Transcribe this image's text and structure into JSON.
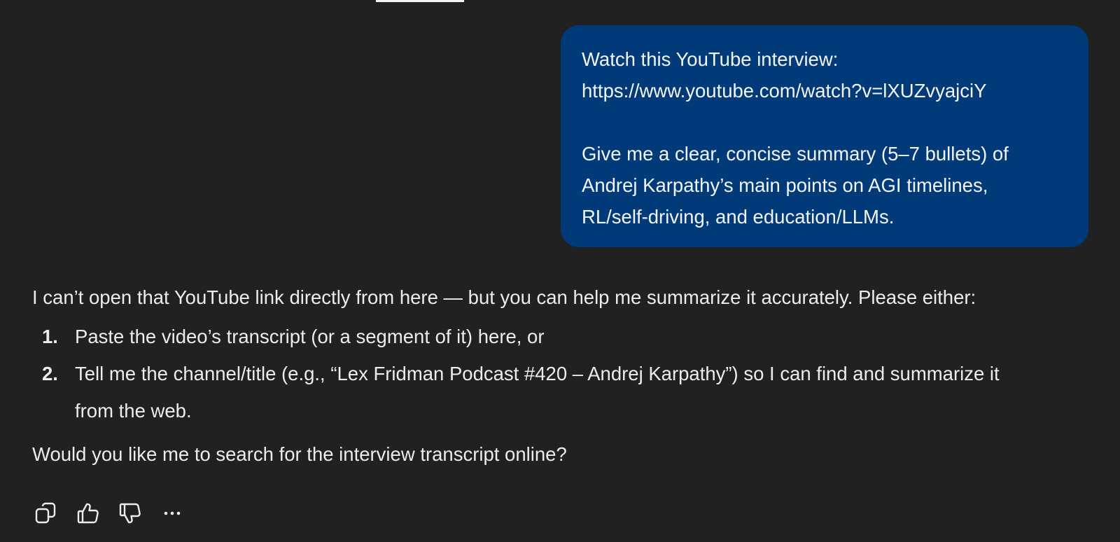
{
  "user_message": {
    "line1": "Watch this YouTube interview:",
    "line2": "https://www.youtube.com/watch?v=lXUZvyajciY",
    "line3": "Give me a clear, concise summary (5–7 bullets) of",
    "line4": "Andrej Karpathy’s main points on AGI timelines,",
    "line5": "RL/self-driving, and education/LLMs."
  },
  "assistant_message": {
    "intro": "I can’t open that YouTube link directly from here — but you can help me summarize it accurately. Please either:",
    "items": [
      {
        "number": "1.",
        "text": "Paste the video’s transcript (or a segment of it) here, or"
      },
      {
        "number": "2.",
        "text": "Tell me the channel/title (e.g., “Lex Fridman Podcast #420 – Andrej Karpathy”) so I can find and summarize it from the web."
      }
    ],
    "outro": "Would you like me to search for the interview transcript online?"
  },
  "actions": {
    "copy_icon": "copy-icon",
    "thumbs_up_icon": "thumbs-up-icon",
    "thumbs_down_icon": "thumbs-down-icon",
    "more_icon": "more-icon"
  },
  "colors": {
    "background": "#212121",
    "user_bubble": "#003a78",
    "text": "#ececec"
  }
}
